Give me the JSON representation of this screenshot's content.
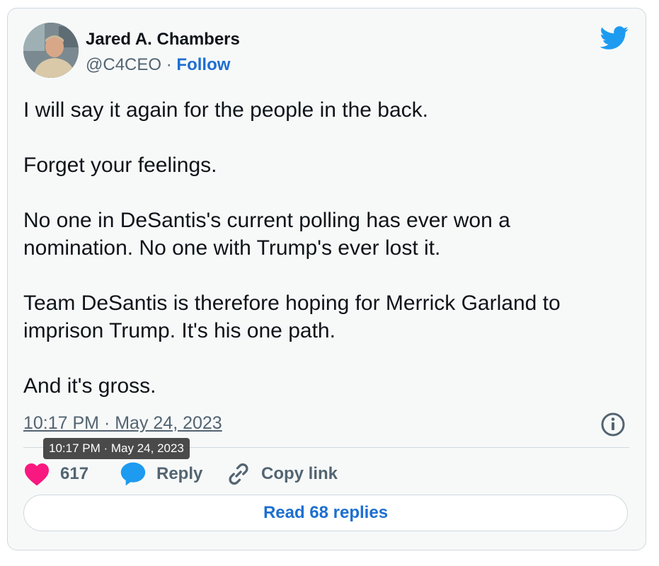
{
  "author": {
    "name": "Jared A. Chambers",
    "handle": "@C4CEO",
    "separator": "·",
    "follow_label": "Follow"
  },
  "tweet": {
    "paragraphs": [
      "I will say it again for the people in the back.",
      "Forget your feelings.",
      "No one in DeSantis's current polling has ever won a nomination. No one with Trump's ever lost it.",
      "Team DeSantis is therefore hoping for Merrick Garland to imprison Trump. It's his one path.",
      "And it's gross."
    ],
    "timestamp": "10:17 PM · May 24, 2023",
    "tooltip": "10:17 PM · May 24, 2023"
  },
  "actions": {
    "like_count": "617",
    "reply_label": "Reply",
    "copy_label": "Copy link"
  },
  "read_replies_label": "Read 68 replies",
  "icons": {
    "brand": "twitter-bird-icon",
    "info": "info-icon",
    "like": "heart-icon",
    "reply": "speech-bubble-icon",
    "copy": "link-icon"
  },
  "colors": {
    "brand_blue": "#1d9bf0",
    "link_blue": "#1d6fd1",
    "heart_pink": "#f91880",
    "muted": "#536471"
  }
}
